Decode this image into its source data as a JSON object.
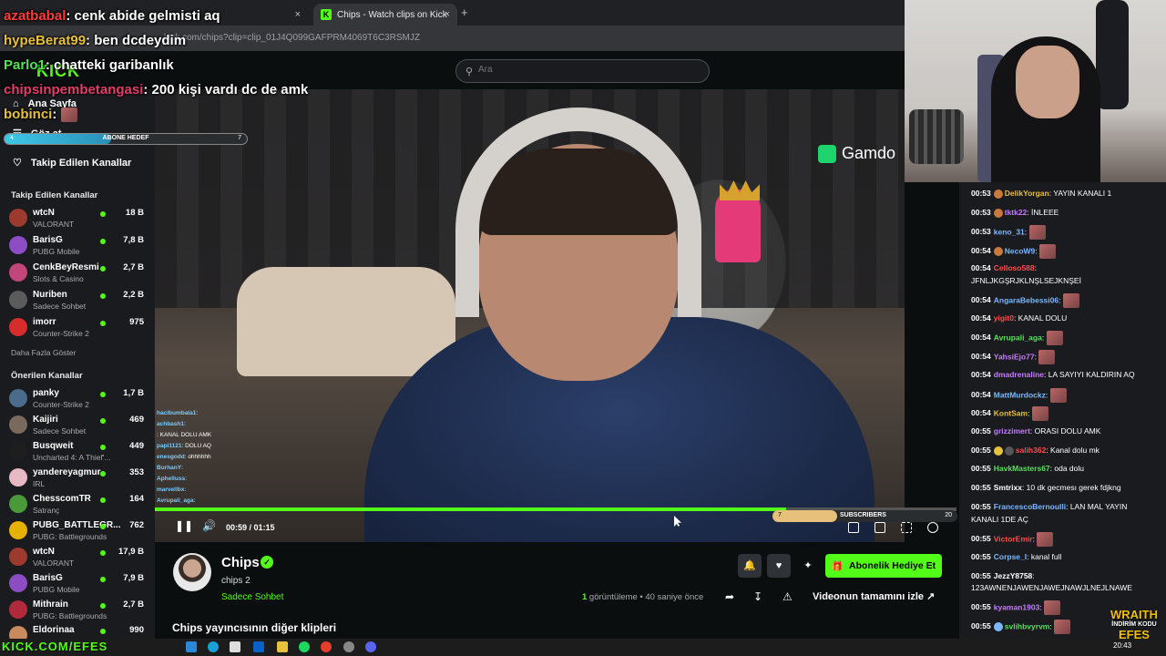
{
  "browser": {
    "tabs": [
      {
        "label": "Chips - Watch clips on Kick"
      }
    ],
    "url": "kick.com/chips?clip=clip_01J4Q099GAFPRM4069T6C3RSMJZ",
    "new_tab": "+",
    "close": "×"
  },
  "header": {
    "search_placeholder": "Ara",
    "logo": "KICK"
  },
  "sidebar": {
    "nav": [
      {
        "label": "Ana Sayfa"
      },
      {
        "label": "Göz at"
      },
      {
        "label": "Takip Edilen Kanallar"
      }
    ],
    "followed_heading": "Takip Edilen Kanallar",
    "followed": [
      {
        "name": "wtcN",
        "category": "VALORANT",
        "viewers": "18 B"
      },
      {
        "name": "BarisG",
        "category": "PUBG Mobile",
        "viewers": "7,8 B"
      },
      {
        "name": "CenkBeyResmi",
        "category": "Slots & Casino",
        "viewers": "2,7 B"
      },
      {
        "name": "Nuriben",
        "category": "Sadece Sohbet",
        "viewers": "2,2 B"
      },
      {
        "name": "imorr",
        "category": "Counter-Strike 2",
        "viewers": "975"
      }
    ],
    "show_more": "Daha Fazla Göster",
    "recommended_heading": "Önerilen Kanallar",
    "recommended": [
      {
        "name": "panky",
        "category": "Counter-Strike 2",
        "viewers": "1,7 B"
      },
      {
        "name": "Kaijiri",
        "category": "Sadece Sohbet",
        "viewers": "469"
      },
      {
        "name": "Busqweit",
        "category": "Uncharted 4: A Thief'...",
        "viewers": "449"
      },
      {
        "name": "yandereyagmur",
        "category": "IRL",
        "viewers": "353"
      },
      {
        "name": "ChesscomTR",
        "category": "Satranç",
        "viewers": "164"
      },
      {
        "name": "PUBG_BATTLEGR...",
        "category": "PUBG: Battlegrounds",
        "viewers": "762"
      },
      {
        "name": "wtcN",
        "category": "VALORANT",
        "viewers": "17,9 B"
      },
      {
        "name": "BarisG",
        "category": "PUBG Mobile",
        "viewers": "7,9 B"
      },
      {
        "name": "Mithrain",
        "category": "PUBG: Battlegrounds",
        "viewers": "2,7 B"
      },
      {
        "name": "Eldorinaa",
        "category": "",
        "viewers": "990"
      }
    ]
  },
  "stream_overlay": {
    "chat": [
      {
        "user": "azatbabal",
        "color": "#ff3b3b",
        "msg": ": cenk abide gelmisti aq"
      },
      {
        "user": "hypeBerat99",
        "color": "#e7c03c",
        "msg": ": ben dcdeydim"
      },
      {
        "user": "Parlo1",
        "color": "#59e05b",
        "msg": ": chatteki garibanlık"
      },
      {
        "user": "chipsinpembetangasi",
        "color": "#e33d6a",
        "msg": ": 200 kişi vardı dc de amk"
      },
      {
        "user": "bobinci",
        "color": "#e7c03c",
        "msg": ":"
      }
    ],
    "sub_goal_label": "ABONE HEDEF",
    "sub_goal_left": "4",
    "sub_goal_right": "7",
    "sub_goal_fraction": 0.44,
    "sponsor": "Gamdo",
    "mini_chat": [
      {
        "user": "hacibumbala1",
        "msg": ":"
      },
      {
        "user": "",
        "msg": ""
      },
      {
        "user": "achbash1",
        "msg": ":"
      },
      {
        "user": "",
        "msg": ": KANAL DOLU AMK"
      },
      {
        "user": "papi1121",
        "msg": ": DOLU AQ"
      },
      {
        "user": "enesgodd",
        "msg": ": ohhhhhh"
      },
      {
        "user": "BurhanY",
        "msg": ":"
      },
      {
        "user": "Aphelluss",
        "msg": ":"
      },
      {
        "user": "marvellbx",
        "msg": ":"
      },
      {
        "user": "Avrupali_aga",
        "msg": ":"
      }
    ],
    "subscribers_label": "SUBSCRIBERS",
    "subscribers_left": "7",
    "subscribers_right": "20",
    "subscribers_fraction": 0.35
  },
  "player": {
    "time": "00:59 / 01:15",
    "progress_fraction": 0.787
  },
  "clip_info": {
    "channel": "Chips",
    "title": "chips 2",
    "category": "Sadece Sohbet",
    "gift_button": "Abonelik Hediye Et",
    "views_count": "1",
    "views_label": " görüntüleme",
    "ago": " • 40 saniye önce",
    "watch_full": "Videonun tamamını izle",
    "more_clips": "Chips yayıncısının diğer klipleri"
  },
  "chat": {
    "messages": [
      {
        "time": "00:53",
        "user": "DelikYorgan",
        "color": "#e7c03c",
        "msg": ": YAYIN KANALI 1",
        "badge": true,
        "emote": false
      },
      {
        "time": "00:53",
        "user": "tktk22",
        "color": "#c67cff",
        "msg": ": İNLEEE",
        "badge": true,
        "emote": false
      },
      {
        "time": "00:53",
        "user": "keno_31",
        "color": "#7cb8ff",
        "msg": ":",
        "badge": false,
        "emote": true
      },
      {
        "time": "00:54",
        "user": "NecoW9",
        "color": "#7cb8ff",
        "msg": ":",
        "badge": true,
        "emote": true
      },
      {
        "time": "00:54",
        "user": "Celloso588",
        "color": "#ff4d4d",
        "msg": ":",
        "badge": false,
        "emote": false
      },
      {
        "time": "",
        "user": "",
        "color": "#fff",
        "msg": "JFNLJKGŞRJKLNŞLSEJKNŞEİ",
        "badge": false,
        "emote": false
      },
      {
        "time": "00:54",
        "user": "AngaraBebessi06",
        "color": "#7cb8ff",
        "msg": ":",
        "badge": false,
        "emote": true
      },
      {
        "time": "00:54",
        "user": "yigit0",
        "color": "#ff4d4d",
        "msg": ": KANAL DOLU",
        "badge": false,
        "emote": false
      },
      {
        "time": "00:54",
        "user": "Avrupali_aga",
        "color": "#59e05b",
        "msg": ":",
        "badge": false,
        "emote": true
      },
      {
        "time": "00:54",
        "user": "YahsiEjo77",
        "color": "#c67cff",
        "msg": ":",
        "badge": false,
        "emote": true
      },
      {
        "time": "00:54",
        "user": "dmadrenaline",
        "color": "#c67cff",
        "msg": ": LA SAYIYI KALDIRIN AQ",
        "badge": false,
        "emote": false
      },
      {
        "time": "00:54",
        "user": "MattMurdockz",
        "color": "#7cb8ff",
        "msg": ":",
        "badge": false,
        "emote": true
      },
      {
        "time": "00:54",
        "user": "KontSam",
        "color": "#e7c03c",
        "msg": ":",
        "badge": false,
        "emote": true
      },
      {
        "time": "00:55",
        "user": "grizzimert",
        "color": "#c67cff",
        "msg": ": ORASI DOLU AMK",
        "badge": false,
        "emote": false
      },
      {
        "time": "00:55",
        "user": "salih362",
        "color": "#ff4d4d",
        "msg": ": Kanal dolu mk",
        "badge": true,
        "emote": false
      },
      {
        "time": "00:55",
        "user": "HavkMasters67",
        "color": "#59e05b",
        "msg": ": oda dolu",
        "badge": false,
        "emote": false
      },
      {
        "time": "00:55",
        "user": "Smtrixx",
        "color": "#fff",
        "msg": ": 10 dk gecmesı gerek fdjkng",
        "badge": false,
        "emote": false
      },
      {
        "time": "00:55",
        "user": "FrancescoBernoulli",
        "color": "#7cb8ff",
        "msg": ": LAN MAL YAYIN",
        "badge": false,
        "emote": false
      },
      {
        "time": "",
        "user": "",
        "color": "#fff",
        "msg": "KANALI 1DE AÇ",
        "badge": false,
        "emote": false
      },
      {
        "time": "00:55",
        "user": "VictorEmir",
        "color": "#ff4d4d",
        "msg": ":",
        "badge": false,
        "emote": true
      },
      {
        "time": "00:55",
        "user": "Corpse_I",
        "color": "#7cb8ff",
        "msg": ": kanal full",
        "badge": false,
        "emote": false
      },
      {
        "time": "00:55",
        "user": "JezzY8758",
        "color": "#fff",
        "msg": ":",
        "badge": false,
        "emote": false
      },
      {
        "time": "",
        "user": "",
        "color": "#fff",
        "msg": "123AWNENJAWENJAWEJNAWJLNEJLNAWE",
        "badge": false,
        "emote": false
      },
      {
        "time": "00:55",
        "user": "kyaman1903",
        "color": "#c67cff",
        "msg": ":",
        "badge": false,
        "emote": true
      },
      {
        "time": "00:55",
        "user": "svlihbvyrvm",
        "color": "#59e05b",
        "msg": ":",
        "badge": true,
        "emote": true
      }
    ]
  },
  "wraith": {
    "title": "WRAITH",
    "sub1": "İNDİRİM KODU",
    "sub2": "EFES"
  },
  "taskbar": {
    "kick_tag": "KICK.COM/EFES",
    "clock": "20:43"
  },
  "colors": {
    "accent": "#53fc18",
    "bg": "#0b0e0f",
    "panel": "#191b1f"
  }
}
